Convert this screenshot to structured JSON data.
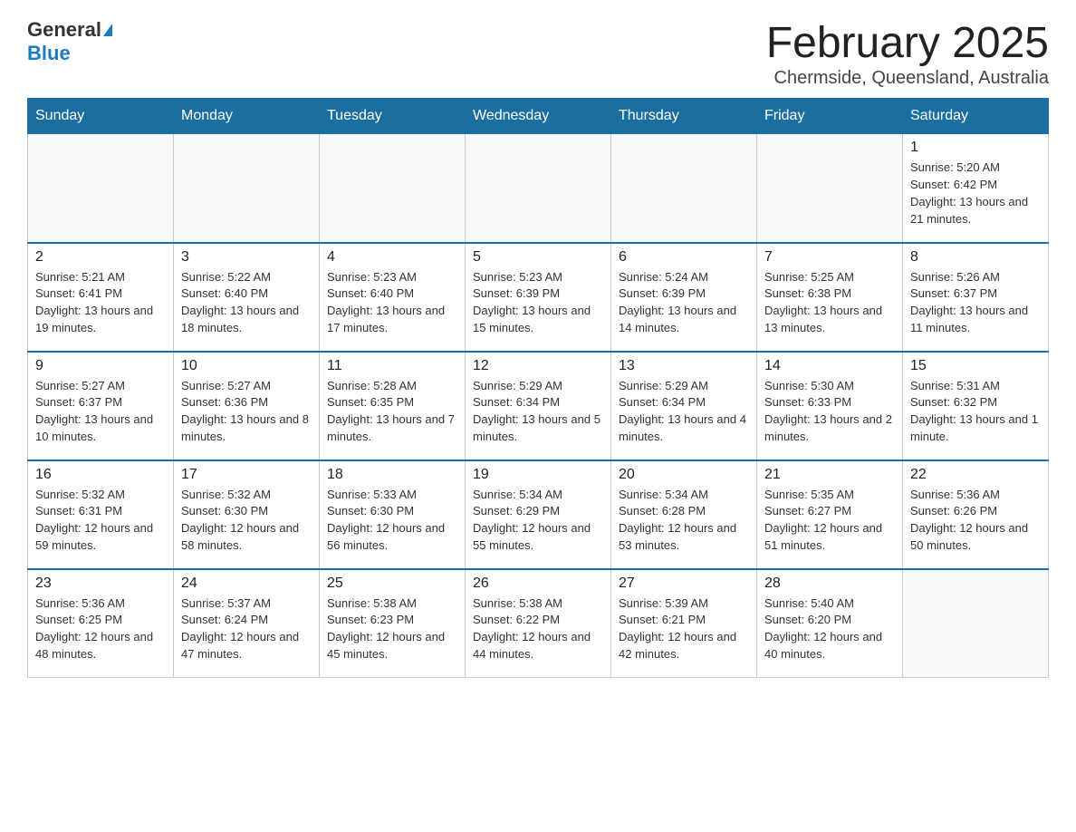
{
  "logo": {
    "general": "General",
    "blue": "Blue"
  },
  "header": {
    "month_year": "February 2025",
    "location": "Chermside, Queensland, Australia"
  },
  "days_of_week": [
    "Sunday",
    "Monday",
    "Tuesday",
    "Wednesday",
    "Thursday",
    "Friday",
    "Saturday"
  ],
  "weeks": [
    [
      {
        "day": "",
        "info": ""
      },
      {
        "day": "",
        "info": ""
      },
      {
        "day": "",
        "info": ""
      },
      {
        "day": "",
        "info": ""
      },
      {
        "day": "",
        "info": ""
      },
      {
        "day": "",
        "info": ""
      },
      {
        "day": "1",
        "info": "Sunrise: 5:20 AM\nSunset: 6:42 PM\nDaylight: 13 hours and 21 minutes."
      }
    ],
    [
      {
        "day": "2",
        "info": "Sunrise: 5:21 AM\nSunset: 6:41 PM\nDaylight: 13 hours and 19 minutes."
      },
      {
        "day": "3",
        "info": "Sunrise: 5:22 AM\nSunset: 6:40 PM\nDaylight: 13 hours and 18 minutes."
      },
      {
        "day": "4",
        "info": "Sunrise: 5:23 AM\nSunset: 6:40 PM\nDaylight: 13 hours and 17 minutes."
      },
      {
        "day": "5",
        "info": "Sunrise: 5:23 AM\nSunset: 6:39 PM\nDaylight: 13 hours and 15 minutes."
      },
      {
        "day": "6",
        "info": "Sunrise: 5:24 AM\nSunset: 6:39 PM\nDaylight: 13 hours and 14 minutes."
      },
      {
        "day": "7",
        "info": "Sunrise: 5:25 AM\nSunset: 6:38 PM\nDaylight: 13 hours and 13 minutes."
      },
      {
        "day": "8",
        "info": "Sunrise: 5:26 AM\nSunset: 6:37 PM\nDaylight: 13 hours and 11 minutes."
      }
    ],
    [
      {
        "day": "9",
        "info": "Sunrise: 5:27 AM\nSunset: 6:37 PM\nDaylight: 13 hours and 10 minutes."
      },
      {
        "day": "10",
        "info": "Sunrise: 5:27 AM\nSunset: 6:36 PM\nDaylight: 13 hours and 8 minutes."
      },
      {
        "day": "11",
        "info": "Sunrise: 5:28 AM\nSunset: 6:35 PM\nDaylight: 13 hours and 7 minutes."
      },
      {
        "day": "12",
        "info": "Sunrise: 5:29 AM\nSunset: 6:34 PM\nDaylight: 13 hours and 5 minutes."
      },
      {
        "day": "13",
        "info": "Sunrise: 5:29 AM\nSunset: 6:34 PM\nDaylight: 13 hours and 4 minutes."
      },
      {
        "day": "14",
        "info": "Sunrise: 5:30 AM\nSunset: 6:33 PM\nDaylight: 13 hours and 2 minutes."
      },
      {
        "day": "15",
        "info": "Sunrise: 5:31 AM\nSunset: 6:32 PM\nDaylight: 13 hours and 1 minute."
      }
    ],
    [
      {
        "day": "16",
        "info": "Sunrise: 5:32 AM\nSunset: 6:31 PM\nDaylight: 12 hours and 59 minutes."
      },
      {
        "day": "17",
        "info": "Sunrise: 5:32 AM\nSunset: 6:30 PM\nDaylight: 12 hours and 58 minutes."
      },
      {
        "day": "18",
        "info": "Sunrise: 5:33 AM\nSunset: 6:30 PM\nDaylight: 12 hours and 56 minutes."
      },
      {
        "day": "19",
        "info": "Sunrise: 5:34 AM\nSunset: 6:29 PM\nDaylight: 12 hours and 55 minutes."
      },
      {
        "day": "20",
        "info": "Sunrise: 5:34 AM\nSunset: 6:28 PM\nDaylight: 12 hours and 53 minutes."
      },
      {
        "day": "21",
        "info": "Sunrise: 5:35 AM\nSunset: 6:27 PM\nDaylight: 12 hours and 51 minutes."
      },
      {
        "day": "22",
        "info": "Sunrise: 5:36 AM\nSunset: 6:26 PM\nDaylight: 12 hours and 50 minutes."
      }
    ],
    [
      {
        "day": "23",
        "info": "Sunrise: 5:36 AM\nSunset: 6:25 PM\nDaylight: 12 hours and 48 minutes."
      },
      {
        "day": "24",
        "info": "Sunrise: 5:37 AM\nSunset: 6:24 PM\nDaylight: 12 hours and 47 minutes."
      },
      {
        "day": "25",
        "info": "Sunrise: 5:38 AM\nSunset: 6:23 PM\nDaylight: 12 hours and 45 minutes."
      },
      {
        "day": "26",
        "info": "Sunrise: 5:38 AM\nSunset: 6:22 PM\nDaylight: 12 hours and 44 minutes."
      },
      {
        "day": "27",
        "info": "Sunrise: 5:39 AM\nSunset: 6:21 PM\nDaylight: 12 hours and 42 minutes."
      },
      {
        "day": "28",
        "info": "Sunrise: 5:40 AM\nSunset: 6:20 PM\nDaylight: 12 hours and 40 minutes."
      },
      {
        "day": "",
        "info": ""
      }
    ]
  ]
}
